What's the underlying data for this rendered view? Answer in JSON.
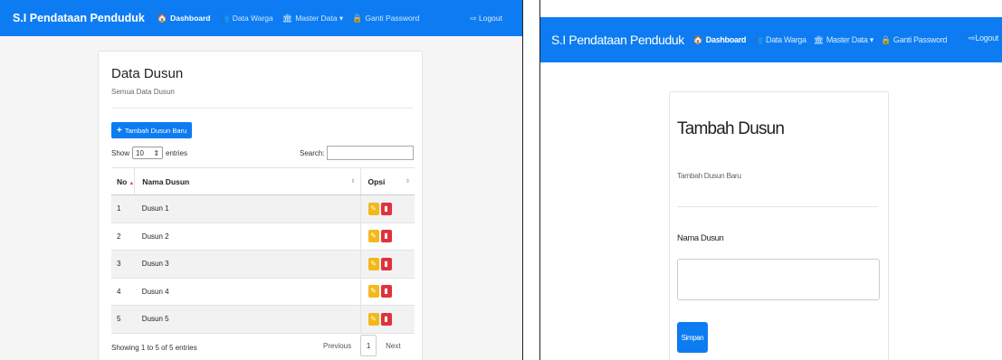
{
  "left": {
    "navbar": {
      "brand": "S.I Pendataan Penduduk",
      "items": [
        {
          "icon": "home-icon",
          "glyph": "🏠",
          "label": "Dashboard"
        },
        {
          "icon": "users-icon",
          "glyph": "👥",
          "label": "Data Warga"
        },
        {
          "icon": "bank-icon",
          "glyph": "🏛",
          "label": "Master Data ▾"
        },
        {
          "icon": "lock-icon",
          "glyph": "🔒",
          "label": "Ganti Password"
        }
      ],
      "logout": "Logout"
    },
    "card": {
      "title": "Data Dusun",
      "subtitle": "Semua Data Dusun",
      "add_button": "Tambah Dusun Baru",
      "show_label": "Show",
      "entries_value": "10",
      "entries_label": "entries",
      "search_label": "Search:",
      "table": {
        "columns": [
          "No",
          "Nama Dusun",
          "Opsi"
        ],
        "rows": [
          {
            "no": "1",
            "name": "Dusun 1"
          },
          {
            "no": "2",
            "name": "Dusun 2"
          },
          {
            "no": "3",
            "name": "Dusun 3"
          },
          {
            "no": "4",
            "name": "Dusun 4"
          },
          {
            "no": "5",
            "name": "Dusun 5"
          }
        ]
      },
      "info": "Showing 1 to 5 of 5 entries",
      "pagination": {
        "previous": "Previous",
        "page": "1",
        "next": "Next"
      }
    }
  },
  "right": {
    "navbar": {
      "brand": "S.I Pendataan Penduduk",
      "items": [
        {
          "icon": "home-icon",
          "glyph": "🏠",
          "label": "Dashboard"
        },
        {
          "icon": "users-icon",
          "glyph": "👥",
          "label": "Data Warga"
        },
        {
          "icon": "bank-icon",
          "glyph": "🏛",
          "label": "Master Data ▾"
        },
        {
          "icon": "lock-icon",
          "glyph": "🔒",
          "label": "Ganti Password"
        }
      ],
      "logout": "Logout"
    },
    "form": {
      "title": "Tambah Dusun",
      "subtitle": "Tambah Dusun Baru",
      "field_label": "Nama Dusun",
      "field_value": "",
      "submit": "Simpan"
    }
  },
  "colors": {
    "primary": "#0d7cf2",
    "edit": "#f4b81a",
    "delete": "#e0323c"
  }
}
